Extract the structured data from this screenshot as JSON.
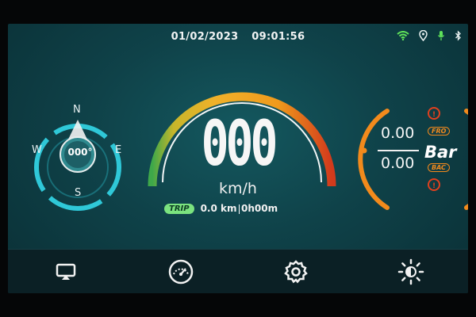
{
  "status_bar": {
    "date": "01/02/2023",
    "time": "09:01:56",
    "icons": [
      "wifi-icon",
      "location-icon",
      "microphone-icon",
      "bluetooth-icon"
    ]
  },
  "speedometer": {
    "speed": "000",
    "unit": "km/h",
    "arc_colors": [
      "#3ea84a",
      "#e6b12a",
      "#f0a51e",
      "#d73a1c"
    ]
  },
  "trip": {
    "badge": "TRIP",
    "distance": "0.0 km",
    "duration": "0h00m"
  },
  "compass": {
    "north": "N",
    "east": "E",
    "south": "S",
    "west": "W",
    "heading": "000°",
    "ring_color": "#2fc8d8"
  },
  "tire_pressure": {
    "front_value": "0.00",
    "back_value": "0.00",
    "unit": "Bar",
    "front_tag": "FRO",
    "back_tag": "BAC",
    "accent_color": "#f28a1c"
  },
  "nav": {
    "items": [
      "screen-mirror-icon",
      "gauge-icon",
      "settings-gear-icon",
      "brightness-icon"
    ]
  }
}
